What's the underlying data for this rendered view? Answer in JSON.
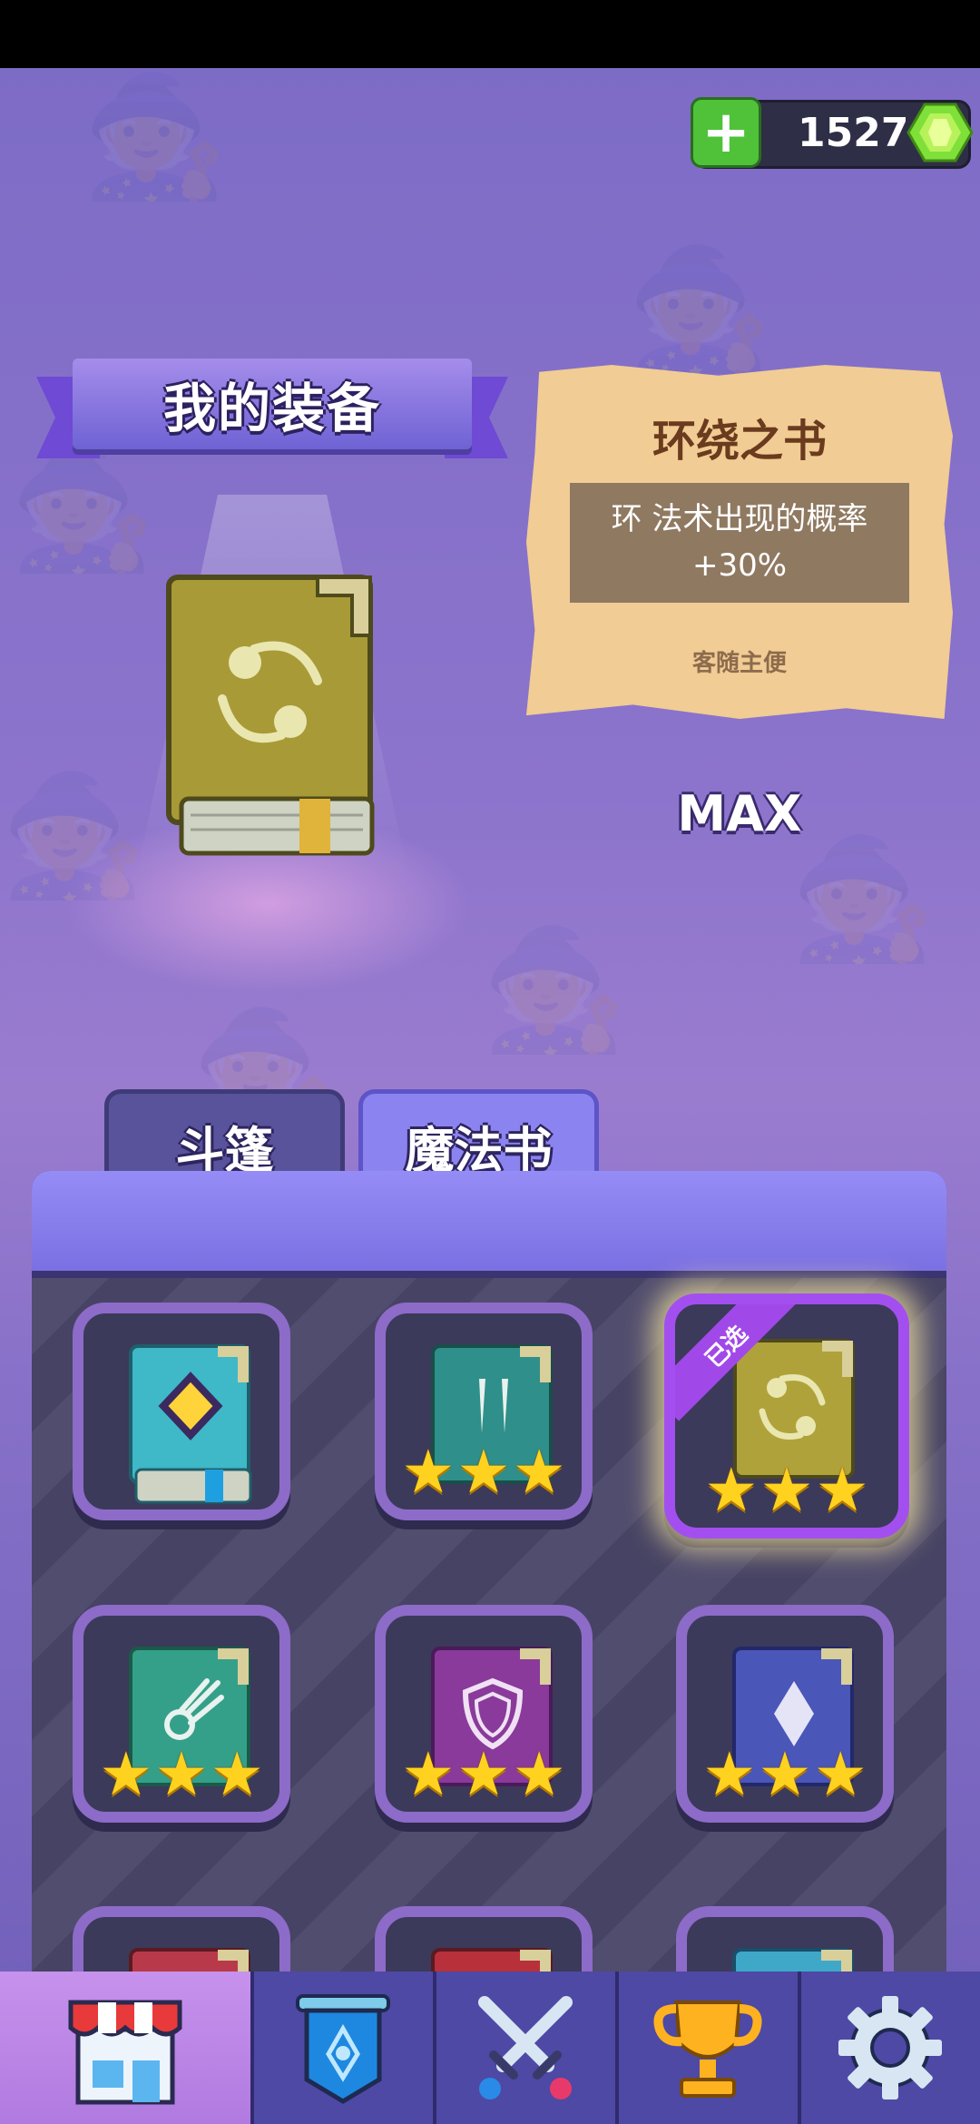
{
  "currency": {
    "gems": "1527",
    "add_label": "+"
  },
  "equipment": {
    "title": "我的装备",
    "item_name": "环绕之书",
    "item_desc_line1": "环 法术出现的概率",
    "item_desc_line2": "+30%",
    "item_note": "客随主便",
    "level_label": "MAX"
  },
  "tabs": [
    {
      "label": "斗篷",
      "active": false
    },
    {
      "label": "魔法书",
      "active": true
    }
  ],
  "books": [
    {
      "icon": "diamond-gem-icon",
      "color": "#3fb8c8",
      "stars": 0,
      "selected": false
    },
    {
      "icon": "fangs-icon",
      "color": "#2f8f8a",
      "stars": 3,
      "selected": false
    },
    {
      "icon": "orbit-icon",
      "color": "#b0a23a",
      "stars": 3,
      "selected": true,
      "tag": "已选"
    },
    {
      "icon": "comet-icon",
      "color": "#35a08a",
      "stars": 3,
      "selected": false
    },
    {
      "icon": "shield-icon",
      "color": "#8a3a9a",
      "stars": 3,
      "selected": false
    },
    {
      "icon": "crystal-icon",
      "color": "#4a56b8",
      "stars": 3,
      "selected": false
    }
  ],
  "nav": [
    {
      "name": "shop",
      "icon": "shop-icon",
      "active": true
    },
    {
      "name": "banner",
      "icon": "banner-icon",
      "active": false
    },
    {
      "name": "battle",
      "icon": "crossed-swords-icon",
      "active": false
    },
    {
      "name": "trophy",
      "icon": "trophy-icon",
      "active": false
    },
    {
      "name": "settings",
      "icon": "gear-icon",
      "active": false
    }
  ],
  "colors": {
    "accent": "#8b84f0",
    "gem": "#7fe03a",
    "star": "#ffd21f",
    "scroll": "#f1cc94"
  }
}
